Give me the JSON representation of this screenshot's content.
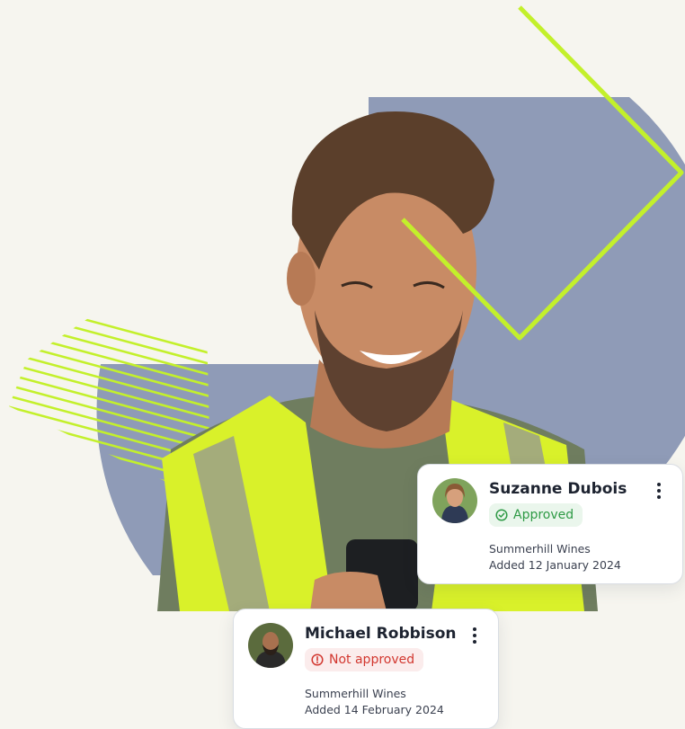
{
  "theme": {
    "background": "#f6f5ef",
    "accent_lime": "#c3f02b",
    "circle_blue": "#8f9bb7",
    "approved_color": "#2e9a45",
    "not_approved_color": "#d2372f"
  },
  "hero": {
    "image": "smiling-worker-in-hi-vis-vest-using-phone",
    "decorations": [
      "lime-diamond-outline",
      "lime-striped-hatching",
      "slate-blue-circle"
    ]
  },
  "cards": [
    {
      "name": "Suzanne Dubois",
      "status": "Approved",
      "status_icon": "check-circle-icon",
      "company": "Summerhill Wines",
      "added": "Added 12 January 2024",
      "menu_icon": "vertical-dots-icon"
    },
    {
      "name": "Michael Robbison",
      "status": "Not approved",
      "status_icon": "alert-circle-icon",
      "company": "Summerhill Wines",
      "added": "Added 14 February 2024",
      "menu_icon": "vertical-dots-icon"
    }
  ]
}
